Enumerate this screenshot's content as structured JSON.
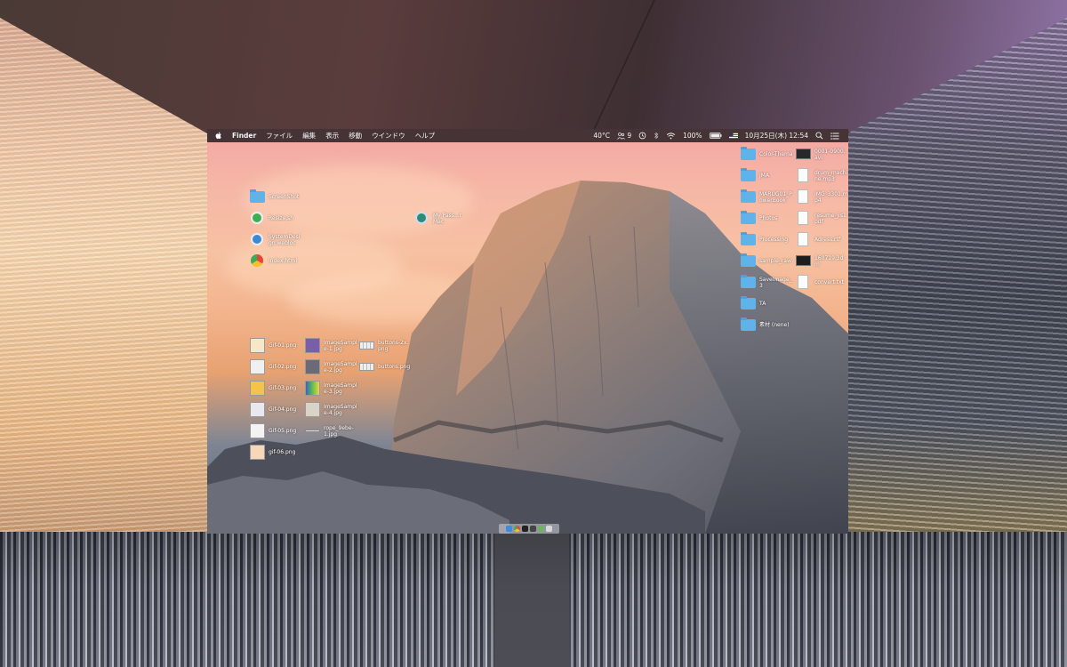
{
  "menubar": {
    "app_name": "Finder",
    "menus": [
      "ファイル",
      "編集",
      "表示",
      "移動",
      "ウインドウ",
      "ヘルプ"
    ],
    "status": {
      "temperature": "40°C",
      "users_count": "9",
      "battery": "100%",
      "datetime": "10月25日(木)  12:54"
    }
  },
  "desktop_left": [
    {
      "label": "ScreenShot",
      "kind": "folder"
    },
    {
      "label": "Resize.sh",
      "kind": "script"
    },
    {
      "label": "SystemDesign.webloc",
      "kind": "webloc"
    },
    {
      "label": "index.html",
      "kind": "html"
    }
  ],
  "backup_icon": {
    "label": "My Pass...r Mac",
    "kind": "backup"
  },
  "png_col1": [
    "Gif-01.png",
    "Gif-02.png",
    "Gif-03.png",
    "Gif-04.png",
    "Gif-05.png",
    "gif-06.png"
  ],
  "png_col2": [
    "ImageSample-1.jpg",
    "ImageSample-2.jpg",
    "ImageSample-3.jpg",
    "ImageSample-4.jpg",
    "rope_9ebe-1.jpg"
  ],
  "png_col3": [
    "buttons-2x.png",
    "buttons.png"
  ],
  "folders_right": [
    "Color-Thema",
    "JMA",
    "MARUG01_PowerBook",
    "Photos",
    "Processing",
    "sample_raw",
    "SaveImage_3",
    "TA",
    "素材 (nene)"
  ],
  "files_right": [
    "0001-0900.avi",
    "drum_machine.mp3",
    "IMG_3301.mp4",
    "resume_jis1.pdf",
    "Adress.rtf",
    "160719.3dm",
    "convert.txt"
  ],
  "colors": {
    "folder_blue": "#5fb3ea",
    "menubar": "#1a1719"
  }
}
